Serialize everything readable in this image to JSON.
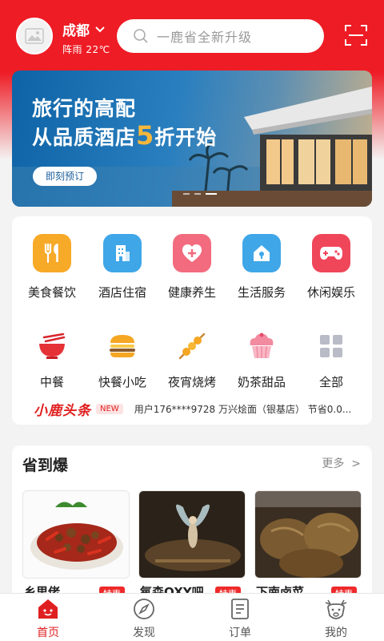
{
  "header": {
    "city": "成都",
    "weather": "阵雨 22℃",
    "search_placeholder": "一鹿省全新升级"
  },
  "banner": {
    "title_line1": "旅行的高配",
    "title_line2_prefix": "从品质酒店",
    "title_line2_highlight": "5",
    "title_line2_suffix": "折开始",
    "button": "即刻预订",
    "highlight_color": "#f6b73c"
  },
  "categories_primary": [
    {
      "label": "美食餐饮",
      "icon": "fork-knife-icon",
      "color": "#f7a928"
    },
    {
      "label": "酒店住宿",
      "icon": "building-icon",
      "color": "#3fa6e8"
    },
    {
      "label": "健康养生",
      "icon": "heart-plus-icon",
      "color": "#f26b7e"
    },
    {
      "label": "生活服务",
      "icon": "house-icon",
      "color": "#3fa6e8"
    },
    {
      "label": "休闲娱乐",
      "icon": "gamepad-icon",
      "color": "#f0465a"
    }
  ],
  "categories_secondary": [
    {
      "label": "中餐",
      "icon": "bowl-chopsticks-icon"
    },
    {
      "label": "快餐小吃",
      "icon": "burger-icon"
    },
    {
      "label": "夜宵烧烤",
      "icon": "skewer-icon"
    },
    {
      "label": "奶茶甜品",
      "icon": "cupcake-icon"
    },
    {
      "label": "全部",
      "icon": "grid-icon"
    }
  ],
  "news": {
    "brand": "小鹿头条",
    "badge": "NEW",
    "text": "用户176****9728 万兴烩面（银基店） 节省0.0..."
  },
  "deals": {
    "title": "省到爆",
    "more": "更多",
    "items": [
      {
        "name": "乡里佬",
        "tag": "特惠"
      },
      {
        "name": "氧森OXY吧",
        "tag": "特惠"
      },
      {
        "name": "下南卤菜",
        "tag": "特惠"
      }
    ]
  },
  "tabbar": [
    {
      "label": "首页",
      "icon": "home-deer-icon",
      "active": true
    },
    {
      "label": "发现",
      "icon": "compass-icon",
      "active": false
    },
    {
      "label": "订单",
      "icon": "order-list-icon",
      "active": false
    },
    {
      "label": "我的",
      "icon": "deer-face-icon",
      "active": false
    }
  ],
  "colors": {
    "brand_red": "#ee1c25",
    "accent_red": "#e02020"
  }
}
